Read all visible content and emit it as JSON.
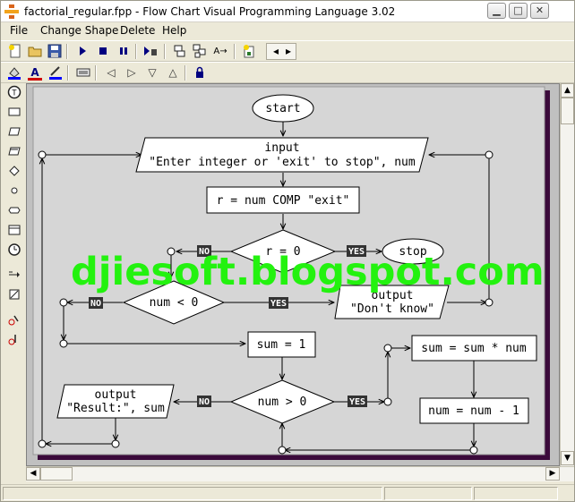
{
  "window": {
    "title": "factorial_regular.fpp - Flow Chart Visual Programming Language 3.02",
    "controls": [
      "minimize",
      "maximize",
      "close"
    ]
  },
  "menu": [
    "File",
    "Change Shape",
    "Delete",
    "Help"
  ],
  "toolbar1_icons": [
    "new-file-icon",
    "open-folder-icon",
    "save-icon",
    "run-icon",
    "stop-icon",
    "pause-icon",
    "step-icon",
    "copy-shapes-icon",
    "paste-shapes-icon",
    "rename-icon",
    "export-icon",
    "nav-left-icon",
    "nav-right-icon"
  ],
  "toolbar2_icons": [
    "fill-color-icon",
    "text-color-icon",
    "line-color-icon",
    "keyboard-icon",
    "arrow-left-icon",
    "arrow-right-icon",
    "arrow-down-icon",
    "arrow-up-icon",
    "lock-icon"
  ],
  "left_tools": [
    "terminal-tool",
    "process-tool",
    "io-tool",
    "io-alt-tool",
    "decision-tool",
    "connector-tool",
    "preparation-tool",
    "display-tool",
    "timer-tool",
    "link-tool",
    "comment-tool",
    "run-mark-tool",
    "stop-mark-tool"
  ],
  "flowchart": {
    "start": "start",
    "input_title": "input",
    "input_prompt": "\"Enter integer or 'exit' to stop\", num",
    "compare": "r = num COMP \"exit\"",
    "decision_r": "r = 0",
    "stop": "stop",
    "decision_neg": "num < 0",
    "output_dont_title": "output",
    "output_dont_text": "\"Don't know\"",
    "sum_init": "sum = 1",
    "sum_update": "sum = sum * num",
    "num_dec": "num = num - 1",
    "decision_pos": "num > 0",
    "output_result_title": "output",
    "output_result_text": "\"Result:\", sum",
    "yes_label": "YES",
    "no_label": "NO"
  },
  "watermark": "djiesoft.blogspot.com"
}
